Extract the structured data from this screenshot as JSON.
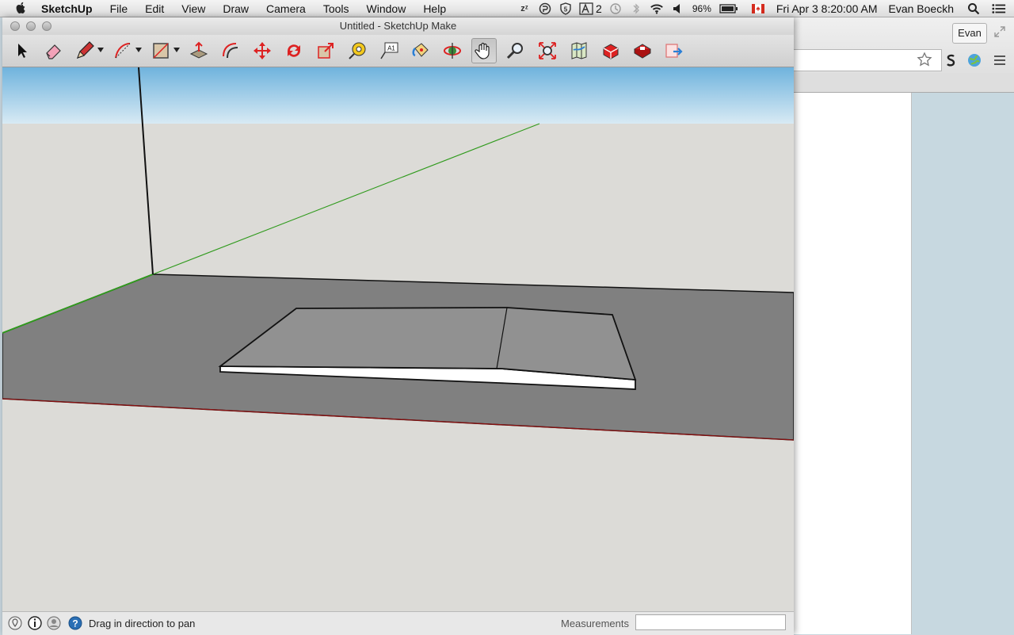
{
  "menubar": {
    "app_name": "SketchUp",
    "items": [
      "File",
      "Edit",
      "View",
      "Draw",
      "Camera",
      "Tools",
      "Window",
      "Help"
    ],
    "status": {
      "adobe_badge_count": "2",
      "battery": "96%",
      "datetime": "Fri Apr 3  8:20:00 AM",
      "user": "Evan Boeckh"
    }
  },
  "window": {
    "title": "Untitled - SketchUp Make"
  },
  "toolbar": {
    "tools": [
      {
        "name": "select-tool",
        "icon": "arrow-cursor-icon"
      },
      {
        "name": "eraser-tool",
        "icon": "eraser-icon"
      },
      {
        "name": "line-tool",
        "icon": "pencil-icon"
      },
      {
        "name": "arc-tool",
        "icon": "arc-icon"
      },
      {
        "name": "rectangle-tool",
        "icon": "rectangle-icon"
      },
      {
        "name": "push-pull-tool",
        "icon": "push-pull-icon"
      },
      {
        "name": "offset-tool",
        "icon": "offset-icon"
      },
      {
        "name": "move-tool",
        "icon": "move-arrows-icon"
      },
      {
        "name": "rotate-tool",
        "icon": "rotate-icon"
      },
      {
        "name": "scale-tool",
        "icon": "scale-icon"
      },
      {
        "name": "tape-measure-tool",
        "icon": "tape-measure-icon"
      },
      {
        "name": "text-tool",
        "icon": "text-icon"
      },
      {
        "name": "paint-bucket-tool",
        "icon": "paint-bucket-icon"
      },
      {
        "name": "orbit-tool",
        "icon": "orbit-icon"
      },
      {
        "name": "pan-tool",
        "icon": "hand-icon"
      },
      {
        "name": "zoom-tool",
        "icon": "magnifier-icon"
      },
      {
        "name": "zoom-extents-tool",
        "icon": "zoom-extents-icon"
      },
      {
        "name": "warehouse-tool",
        "icon": "map-icon"
      },
      {
        "name": "3d-warehouse-tool",
        "icon": "warehouse-icon"
      },
      {
        "name": "extension-warehouse-tool",
        "icon": "extension-icon"
      },
      {
        "name": "share-model-tool",
        "icon": "share-icon"
      }
    ],
    "active_tool": "pan-tool",
    "text_tool_label": "A1"
  },
  "statusbar": {
    "message": "Drag in direction to pan",
    "measurements_label": "Measurements",
    "measurements_value": ""
  },
  "browser": {
    "profile_label": "Evan"
  },
  "colors": {
    "sky_top": "#6fb3dd",
    "sky_bottom": "#d8eaf4",
    "ground": "#dcdbd7",
    "plane": "#808080",
    "slab_top": "#919191",
    "slab_edge": "#ffffff",
    "green_axis": "#2f9a1c",
    "red_axis": "#8a1010"
  }
}
